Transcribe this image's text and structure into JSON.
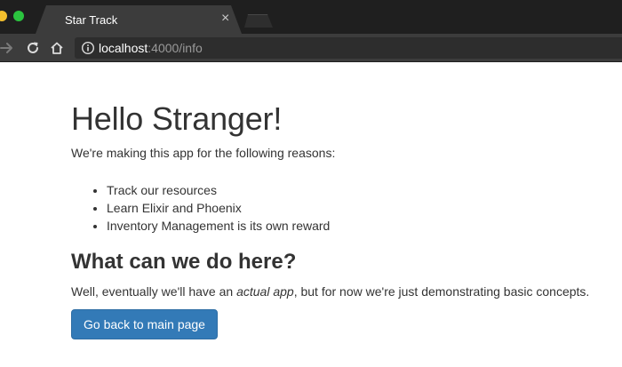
{
  "browser": {
    "tab_title": "Star Track",
    "tab_close_glyph": "×",
    "url_host": "localhost",
    "url_rest": ":4000/info",
    "icons": {
      "forward": "forward-arrow-icon",
      "reload": "reload-icon",
      "home": "home-icon",
      "info": "info-icon",
      "close": "close-icon"
    },
    "colors": {
      "titlebar": "#1f1f1f",
      "toolbar": "#3c3c3c",
      "traffic_yellow": "#f4bf2d",
      "traffic_green": "#2bc43f"
    }
  },
  "page": {
    "title": "Hello Stranger!",
    "intro": "We're making this app for the following reasons:",
    "reasons": [
      "Track our resources",
      "Learn Elixir and Phoenix",
      "Inventory Management is its own reward"
    ],
    "subtitle": "What can we do here?",
    "desc_before": "Well, eventually we'll have an ",
    "desc_emphasis": "actual app",
    "desc_after": ", but for now we're just demonstrating basic concepts.",
    "back_button_label": "Go back to main page",
    "colors": {
      "button": "#337ab7",
      "text": "#333333"
    }
  }
}
